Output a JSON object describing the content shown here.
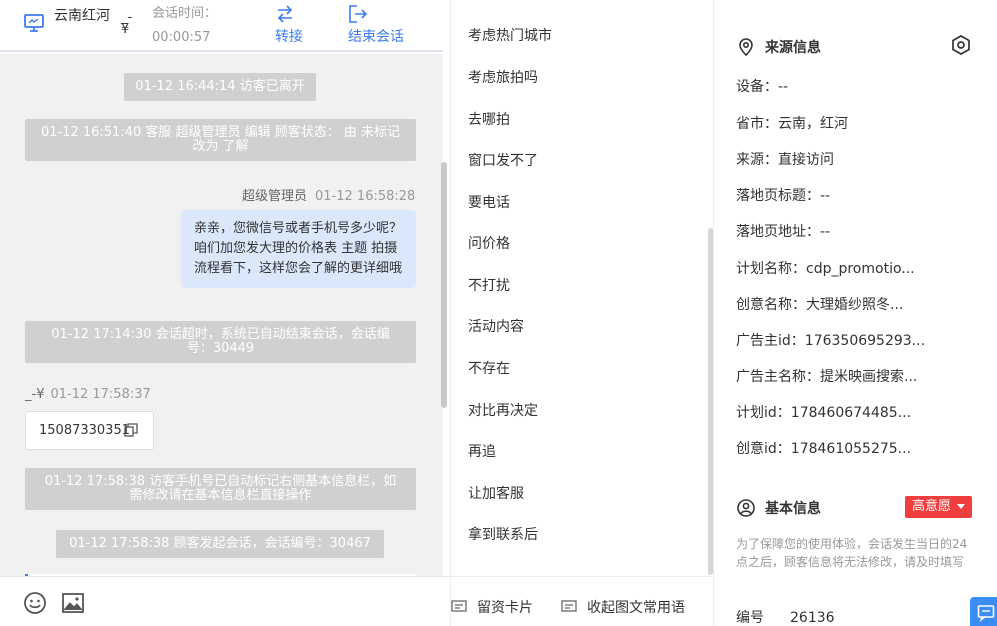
{
  "header": {
    "visitor_name": "云南红河",
    "visitor_tag": "_-¥",
    "session_time_label": "会话时间：",
    "session_time": "00:00:57",
    "transfer_label": "转接",
    "end_label": "结束会话"
  },
  "chat": {
    "messages": [
      {
        "kind": "system",
        "text": "01-12 16:44:14 访客已离开"
      },
      {
        "kind": "system",
        "text": "01-12 16:51:40 客服 超级管理员 编辑 顾客状态： 由 未标记 改为 了解"
      },
      {
        "kind": "agent",
        "sender": "超级管理员",
        "time": "01-12 16:58:28",
        "text": "亲亲，您微信号或者手机号多少呢？咱们加您发大理的价格表 主题 拍摄流程看下，这样您会了解的更详细哦"
      },
      {
        "kind": "system",
        "text": "01-12 17:14:30 会话超时，系统已自动结束会话，会话编号：30449"
      },
      {
        "kind": "visitor",
        "sender": "_-¥",
        "time": "01-12 17:58:37",
        "text": "15087330351"
      },
      {
        "kind": "system",
        "text": "01-12 17:58:38 访客手机号已自动标记右侧基本信息栏，如需修改请在基本信息栏直接操作"
      },
      {
        "kind": "system",
        "text": "01-12 17:58:38 顾客发起会话，会话编号：30467"
      }
    ]
  },
  "input_bar": {
    "emoji_icon": "emoji-icon",
    "image_icon": "image-icon"
  },
  "quick_replies": {
    "items": [
      "考虑热门城市",
      "考虑旅拍吗",
      "去哪拍",
      "窗口发不了",
      "要电话",
      "问价格",
      "不打扰",
      "活动内容",
      "不存在",
      "对比再决定",
      "再追",
      "让加客服",
      "拿到联系后"
    ],
    "bottom": {
      "card_label": "留资卡片",
      "collapse_label": "收起图文常用语"
    }
  },
  "source_info": {
    "title": "来源信息",
    "rows": [
      {
        "label": "设备：",
        "value": "--"
      },
      {
        "label": "省市：",
        "value": "云南，红河"
      },
      {
        "label": "来源：",
        "value": "直接访问"
      },
      {
        "label": "落地页标题：",
        "value": "--"
      },
      {
        "label": "落地页地址：",
        "value": "--"
      },
      {
        "label": "计划名称：",
        "value": "cdp_promotio..."
      },
      {
        "label": "创意名称：",
        "value": "大理婚纱照冬..."
      },
      {
        "label": "广告主id：",
        "value": "176350695293..."
      },
      {
        "label": "广告主名称：",
        "value": "提米映画搜索..."
      },
      {
        "label": "计划id：",
        "value": "178460674485..."
      },
      {
        "label": "创意id：",
        "value": "178461055275..."
      }
    ]
  },
  "basic_info": {
    "title": "基本信息",
    "intent": "高意愿",
    "notice": "为了保障您的使用体验，会话发生当日的24点之后，顾客信息将无法修改，请及时填写",
    "code_label": "编号",
    "code_value": "26136"
  },
  "colors": {
    "accent": "#3b7cf0",
    "intent_red": "#ee3e3e",
    "bubble": "#dbe8fb",
    "system_gray": "#d0d0d0"
  }
}
